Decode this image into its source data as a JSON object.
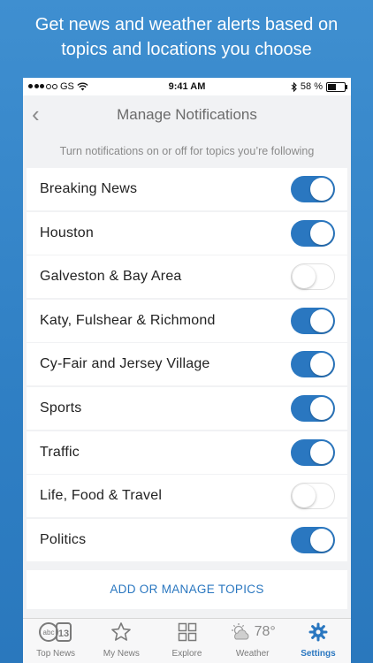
{
  "promo": {
    "line1": "Get news and weather alerts based on",
    "line2": "topics and locations you choose"
  },
  "status_bar": {
    "carrier": "GS",
    "time": "9:41 AM",
    "battery": "58 %",
    "battery_level": 0.58
  },
  "nav": {
    "title": "Manage Notifications",
    "back_icon": "chevron-left-icon"
  },
  "subtitle": "Turn notifications on or off for topics you’re following",
  "topics": [
    {
      "label": "Breaking News",
      "on": true
    },
    {
      "label": "Houston",
      "on": true
    },
    {
      "label": "Galveston & Bay Area",
      "on": false
    },
    {
      "label": "Katy, Fulshear & Richmond",
      "on": true
    },
    {
      "label": "Cy-Fair and Jersey Village",
      "on": true
    },
    {
      "label": "Sports",
      "on": true
    },
    {
      "label": "Traffic",
      "on": true
    },
    {
      "label": "Life, Food & Travel",
      "on": false
    },
    {
      "label": "Politics",
      "on": true
    }
  ],
  "manage_button": "ADD OR MANAGE TOPICS",
  "tabs": [
    {
      "label": "Top News",
      "icon": "abc13-logo-icon",
      "active": false
    },
    {
      "label": "My News",
      "icon": "star-icon",
      "active": false
    },
    {
      "label": "Explore",
      "icon": "grid-icon",
      "active": false
    },
    {
      "label": "Weather",
      "icon": "partly-sunny-icon",
      "active": false,
      "temp": "78°"
    },
    {
      "label": "Settings",
      "icon": "gear-icon",
      "active": true
    }
  ],
  "colors": {
    "accent": "#2a77c0",
    "background_gradient_top": "#3f8fd0",
    "toggle_off_border": "#e0e0e0"
  }
}
